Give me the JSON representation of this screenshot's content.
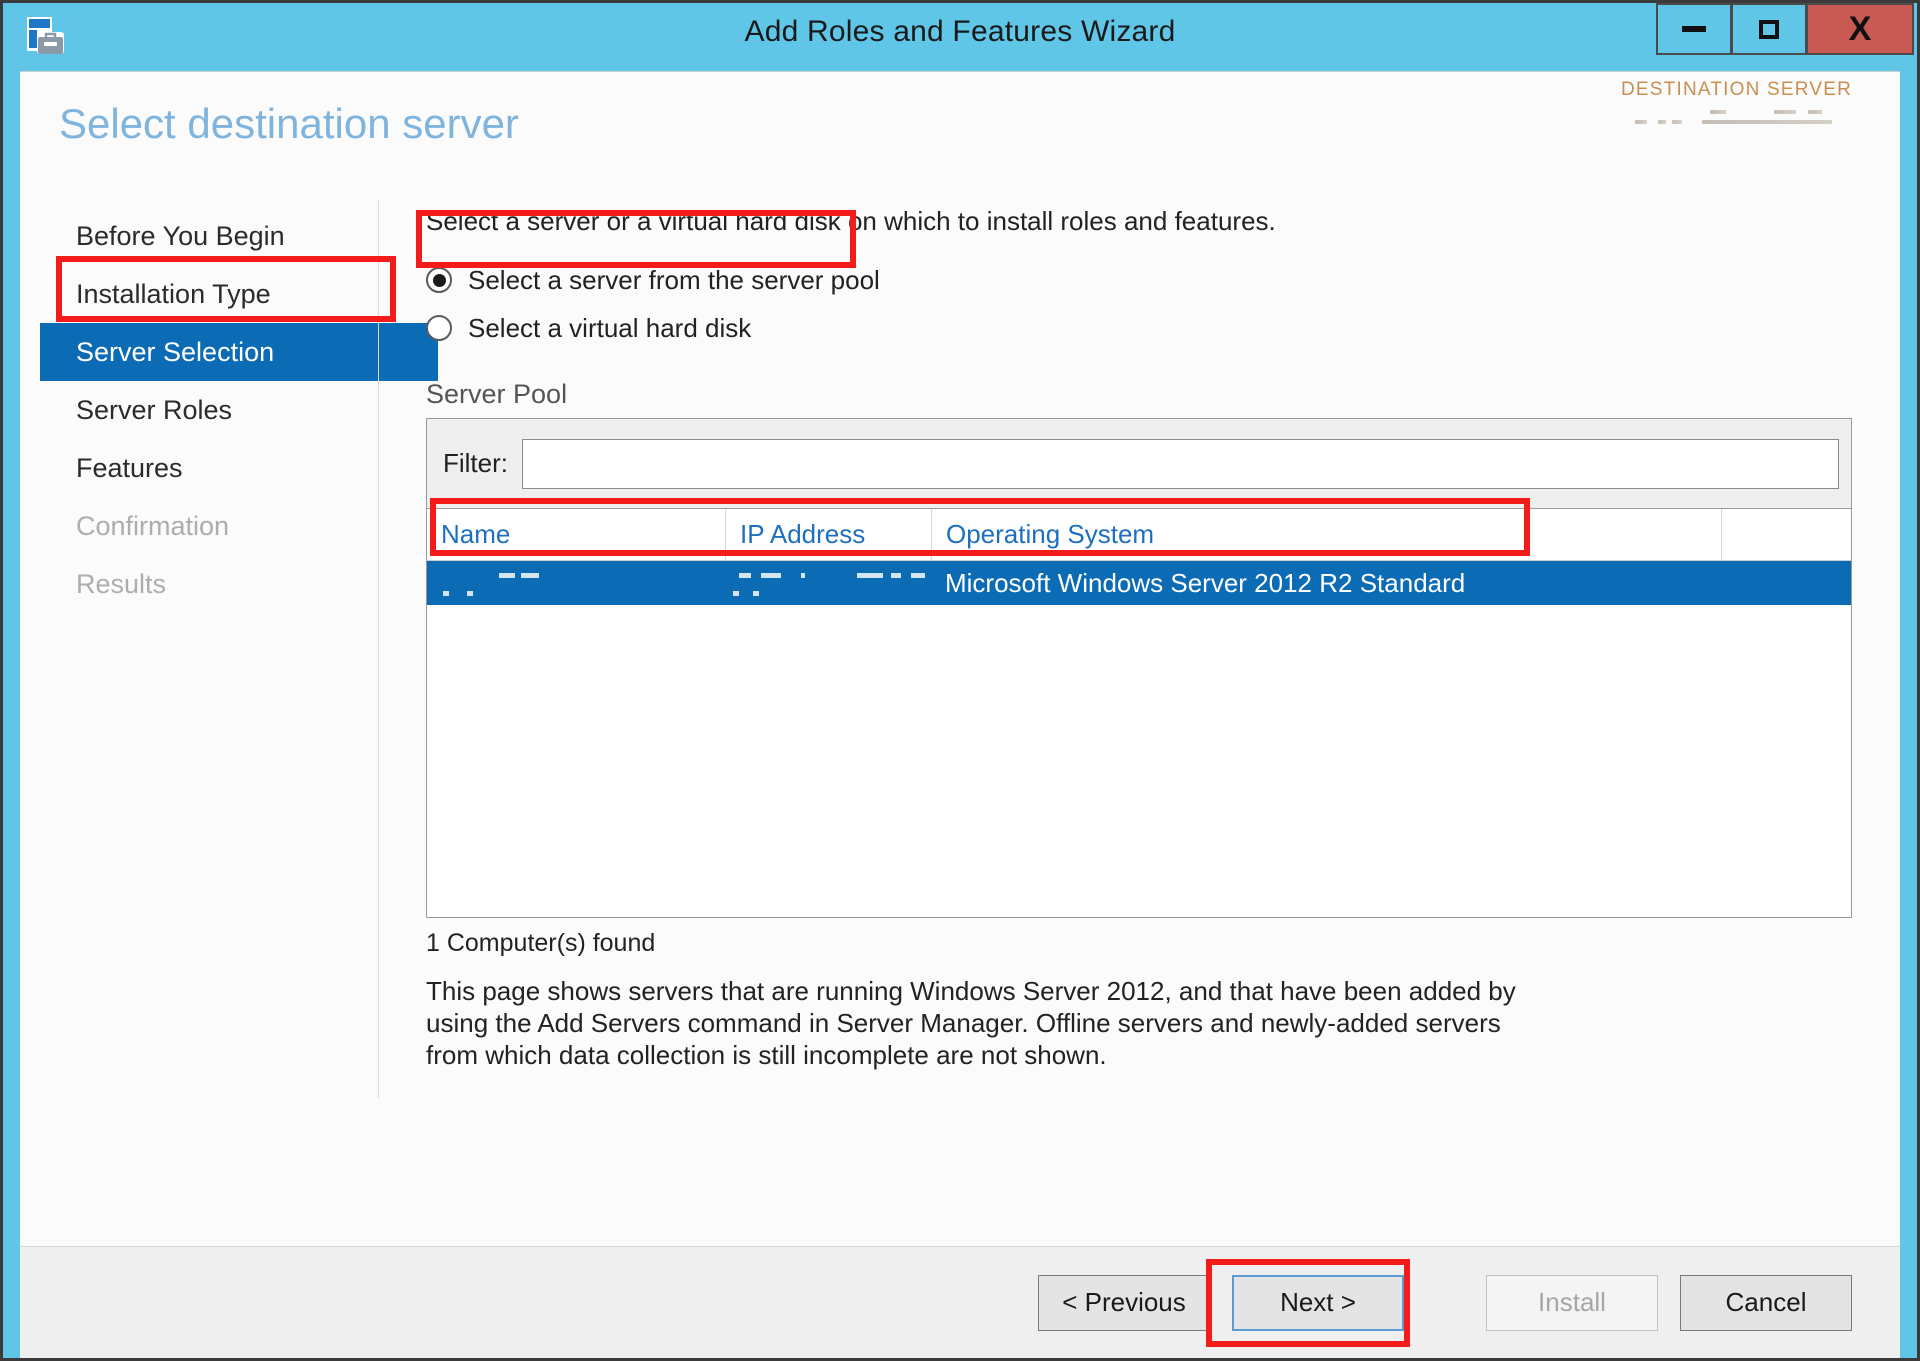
{
  "window": {
    "title": "Add Roles and Features Wizard",
    "icon": "wizard-toolbox-icon",
    "controls": {
      "minimize": "–",
      "maximize": "☐",
      "close": "X"
    },
    "frame_color": "#5FC6E8",
    "close_color": "#C85A53"
  },
  "header": {
    "page_title": "Select destination server",
    "destination_label": "DESTINATION SERVER",
    "destination_value_redacted": true,
    "title_color": "#7FB4DE",
    "destination_label_color": "#C88F50"
  },
  "sidebar": {
    "items": [
      {
        "label": "Before You Begin",
        "state": "normal"
      },
      {
        "label": "Installation Type",
        "state": "normal"
      },
      {
        "label": "Server Selection",
        "state": "active"
      },
      {
        "label": "Server Roles",
        "state": "normal"
      },
      {
        "label": "Features",
        "state": "normal"
      },
      {
        "label": "Confirmation",
        "state": "disabled"
      },
      {
        "label": "Results",
        "state": "disabled"
      }
    ],
    "active_color": "#0C6BB5"
  },
  "content": {
    "intro": "Select a server or a virtual hard disk on which to install roles and features.",
    "radios": [
      {
        "label": "Select a server from the server pool",
        "checked": true
      },
      {
        "label": "Select a virtual hard disk",
        "checked": false
      }
    ],
    "server_pool_title": "Server Pool",
    "filter": {
      "label": "Filter:",
      "value": "",
      "placeholder": ""
    },
    "table": {
      "columns": [
        "Name",
        "IP Address",
        "Operating System",
        ""
      ],
      "header_color": "#1E6FBF",
      "rows": [
        {
          "name": "",
          "name_redacted": true,
          "ip_address": "",
          "ip_redacted": true,
          "operating_system": "Microsoft Windows Server 2012 R2 Standard",
          "selected": true
        }
      ]
    },
    "found_text": "1 Computer(s) found",
    "description": "This page shows servers that are running Windows Server 2012, and that have been added by using the Add Servers command in Server Manager. Offline servers and newly-added servers from which data collection is still incomplete are not shown."
  },
  "footer": {
    "previous_label": "< Previous",
    "next_label": "Next >",
    "install_label": "Install",
    "cancel_label": "Cancel",
    "install_disabled": true,
    "next_focused": true
  },
  "annotations": {
    "color": "#F41B1B",
    "boxes": [
      {
        "target": "sidebar-item-server-selection"
      },
      {
        "target": "radio-server-pool"
      },
      {
        "target": "table-row-selected"
      },
      {
        "target": "next-button"
      }
    ]
  }
}
